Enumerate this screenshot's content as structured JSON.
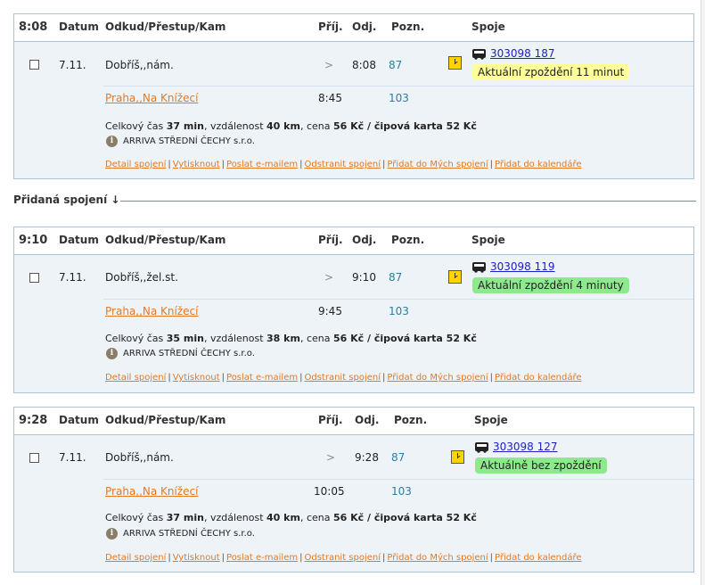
{
  "headers": {
    "datum": "Datum",
    "route": "Odkud/Přestup/Kam",
    "arr": "Příj.",
    "dep": "Odj.",
    "note": "Pozn.",
    "links": "Spoje"
  },
  "added_section": {
    "label": "Přidaná spojení",
    "arrow": "↓"
  },
  "actions": {
    "detail": "Detail spojení",
    "print": "Vytisknout",
    "email": "Poslat e-mailem",
    "remove": "Odstranit spojení",
    "add_mine": "Přidat do Mých spojení",
    "add_calendar": "Přidat do kalendáře",
    "separator": "|"
  },
  "connections": [
    {
      "time": "8:08",
      "date": "7.11.",
      "from": "Dobříš,,nám.",
      "arr_marker": ">",
      "dep_time": "8:08",
      "from_note": "87",
      "to": "Praha,,Na Knížecí",
      "arr_time": "8:45",
      "to_note": "103",
      "line": "303098 187",
      "delay_text": "Aktuální zpoždění 11 minut",
      "delay_color": "#ffff99",
      "total_label": "Celkový čas",
      "total_time": "37 min",
      "distance_label": ", vzdálenost",
      "distance": "40 km",
      "price_label": ", cena",
      "price": "56 Kč / čipová karta 52 Kč",
      "operator": "ARRIVA STŘEDNÍ ČECHY s.r.o."
    },
    {
      "time": "9:10",
      "date": "7.11.",
      "from": "Dobříš,,žel.st.",
      "arr_marker": ">",
      "dep_time": "9:10",
      "from_note": "87",
      "to": "Praha,,Na Knížecí",
      "arr_time": "9:45",
      "to_note": "103",
      "line": "303098 119",
      "delay_text": "Aktuální zpoždění 4 minuty",
      "delay_color": "#8ee88e",
      "total_label": "Celkový čas",
      "total_time": "35 min",
      "distance_label": ", vzdálenost",
      "distance": "38 km",
      "price_label": ", cena",
      "price": "56 Kč / čipová karta 52 Kč",
      "operator": "ARRIVA STŘEDNÍ ČECHY s.r.o."
    },
    {
      "time": "9:28",
      "date": "7.11.",
      "from": "Dobříš,,nám.",
      "arr_marker": ">",
      "dep_time": "9:28",
      "from_note": "87",
      "to": "Praha,,Na Knížecí",
      "arr_time": "10:05",
      "to_note": "103",
      "line": "303098 127",
      "delay_text": "Aktuálně bez zpoždění",
      "delay_color": "#8ee88e",
      "total_label": "Celkový čas",
      "total_time": "37 min",
      "distance_label": ", vzdálenost",
      "distance": "40 km",
      "price_label": ", cena",
      "price": "56 Kč / čipová karta 52 Kč",
      "operator": "ARRIVA STŘEDNÍ ČECHY s.r.o."
    }
  ]
}
